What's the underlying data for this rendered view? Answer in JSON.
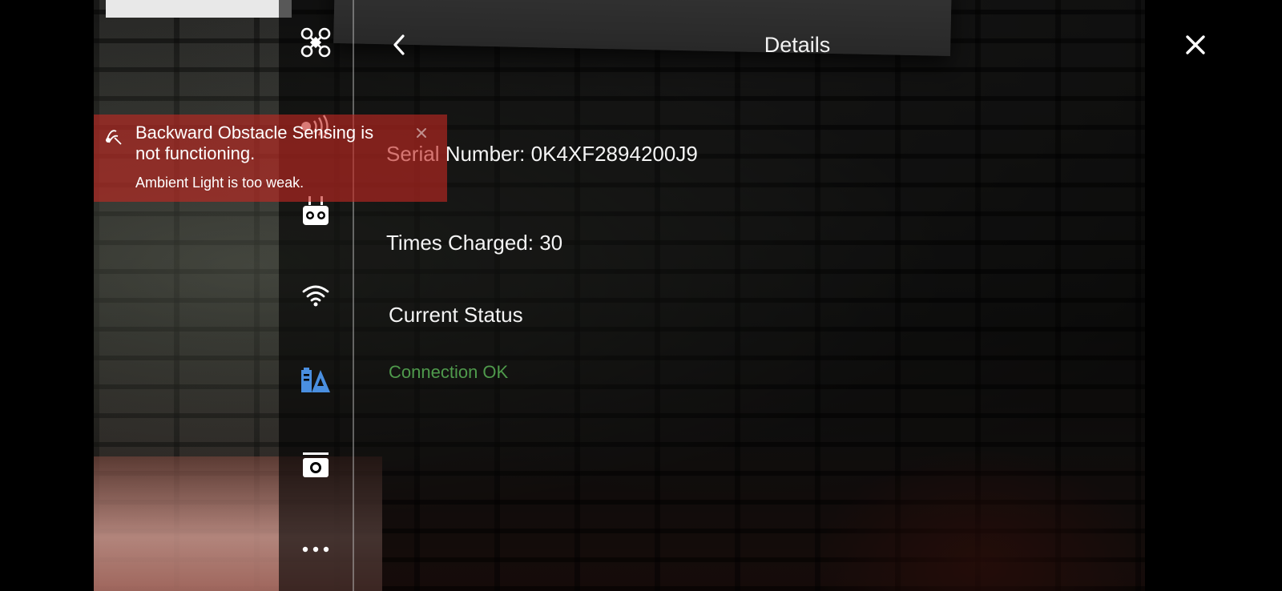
{
  "header": {
    "title": "Details",
    "back_icon": "chevron-left-icon",
    "close_icon": "close-icon"
  },
  "side_rail": {
    "items": [
      {
        "icon": "drone-icon"
      },
      {
        "icon": "obstacle-sensing-icon"
      },
      {
        "icon": "remote-controller-icon"
      },
      {
        "icon": "wifi-icon"
      },
      {
        "icon": "battery-details-icon",
        "active": true,
        "color": "#4a8fe0"
      },
      {
        "icon": "camera-icon"
      },
      {
        "icon": "more-icon"
      }
    ]
  },
  "details": {
    "serial_number": "Serial Number: 0K4XF2894200J9",
    "times_charged": "Times Charged: 30",
    "current_status_heading": "Current Status",
    "status_value": "Connection OK",
    "status_color": "#4f9a4c"
  },
  "alert": {
    "title": "Backward Obstacle Sensing is not functioning.",
    "subtitle": "Ambient Light is too weak.",
    "icon": "obstacle-warning-icon",
    "close_icon": "close-icon",
    "color": "#c42822"
  }
}
